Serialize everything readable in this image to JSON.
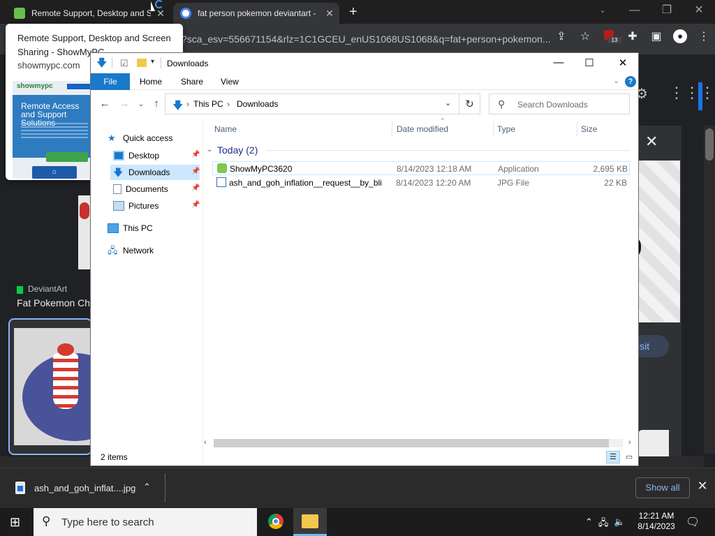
{
  "browser": {
    "tabs": [
      {
        "title": "Remote Support, Desktop and S",
        "close": "✕"
      },
      {
        "title": "fat person pokemon deviantart -",
        "close": "✕"
      }
    ],
    "new_tab": "+",
    "window_controls": {
      "minimize": "—",
      "restore": "❐",
      "close": "✕"
    },
    "url": "?sca_esv=556671154&rlz=1C1GCEU_enUS1068US1068&q=fat+person+pokemon...",
    "extension_badge": "13",
    "hover_card": {
      "title": "Remote Support, Desktop and Screen Sharing - ShowMyPC",
      "domain": "showmypc.com",
      "preview_logo": "showmypc",
      "preview_heading": "Remote Access and Support Solutions"
    },
    "result": {
      "source": "DeviantArt",
      "title": "Fat Pokemon Ch"
    },
    "visit_label": "isit",
    "close_panel": "✕"
  },
  "explorer": {
    "title": "Downloads",
    "ribbon_tabs": [
      "File",
      "Home",
      "Share",
      "View"
    ],
    "breadcrumb": [
      "This PC",
      "Downloads"
    ],
    "search_placeholder": "Search Downloads",
    "nav": {
      "quick_access": "Quick access",
      "items": [
        {
          "label": "Desktop",
          "icon": "desktop-icon",
          "pinned": true
        },
        {
          "label": "Downloads",
          "icon": "downloads-icon",
          "pinned": true,
          "selected": true
        },
        {
          "label": "Documents",
          "icon": "documents-icon",
          "pinned": true
        },
        {
          "label": "Pictures",
          "icon": "pictures-icon",
          "pinned": true
        }
      ],
      "this_pc": "This PC",
      "network": "Network"
    },
    "columns": [
      "Name",
      "Date modified",
      "Type",
      "Size"
    ],
    "group": "Today (2)",
    "files": [
      {
        "name": "ShowMyPC3620",
        "date": "8/14/2023 12:18 AM",
        "type": "Application",
        "size": "2,695 KB"
      },
      {
        "name": "ash_and_goh_inflation__request__by_bli...",
        "date": "8/14/2023 12:20 AM",
        "type": "JPG File",
        "size": "22 KB"
      }
    ],
    "status": "2 items"
  },
  "download_bar": {
    "file": "ash_and_goh_inflat....jpg",
    "show_all": "Show all"
  },
  "taskbar": {
    "search_placeholder": "Type here to search",
    "time": "12:21 AM",
    "date": "8/14/2023"
  },
  "colors": {
    "file_tab": "#1979ca",
    "selection": "#cce8ff",
    "group_header": "#1e3287",
    "chrome_link": "#8ab4f8"
  }
}
